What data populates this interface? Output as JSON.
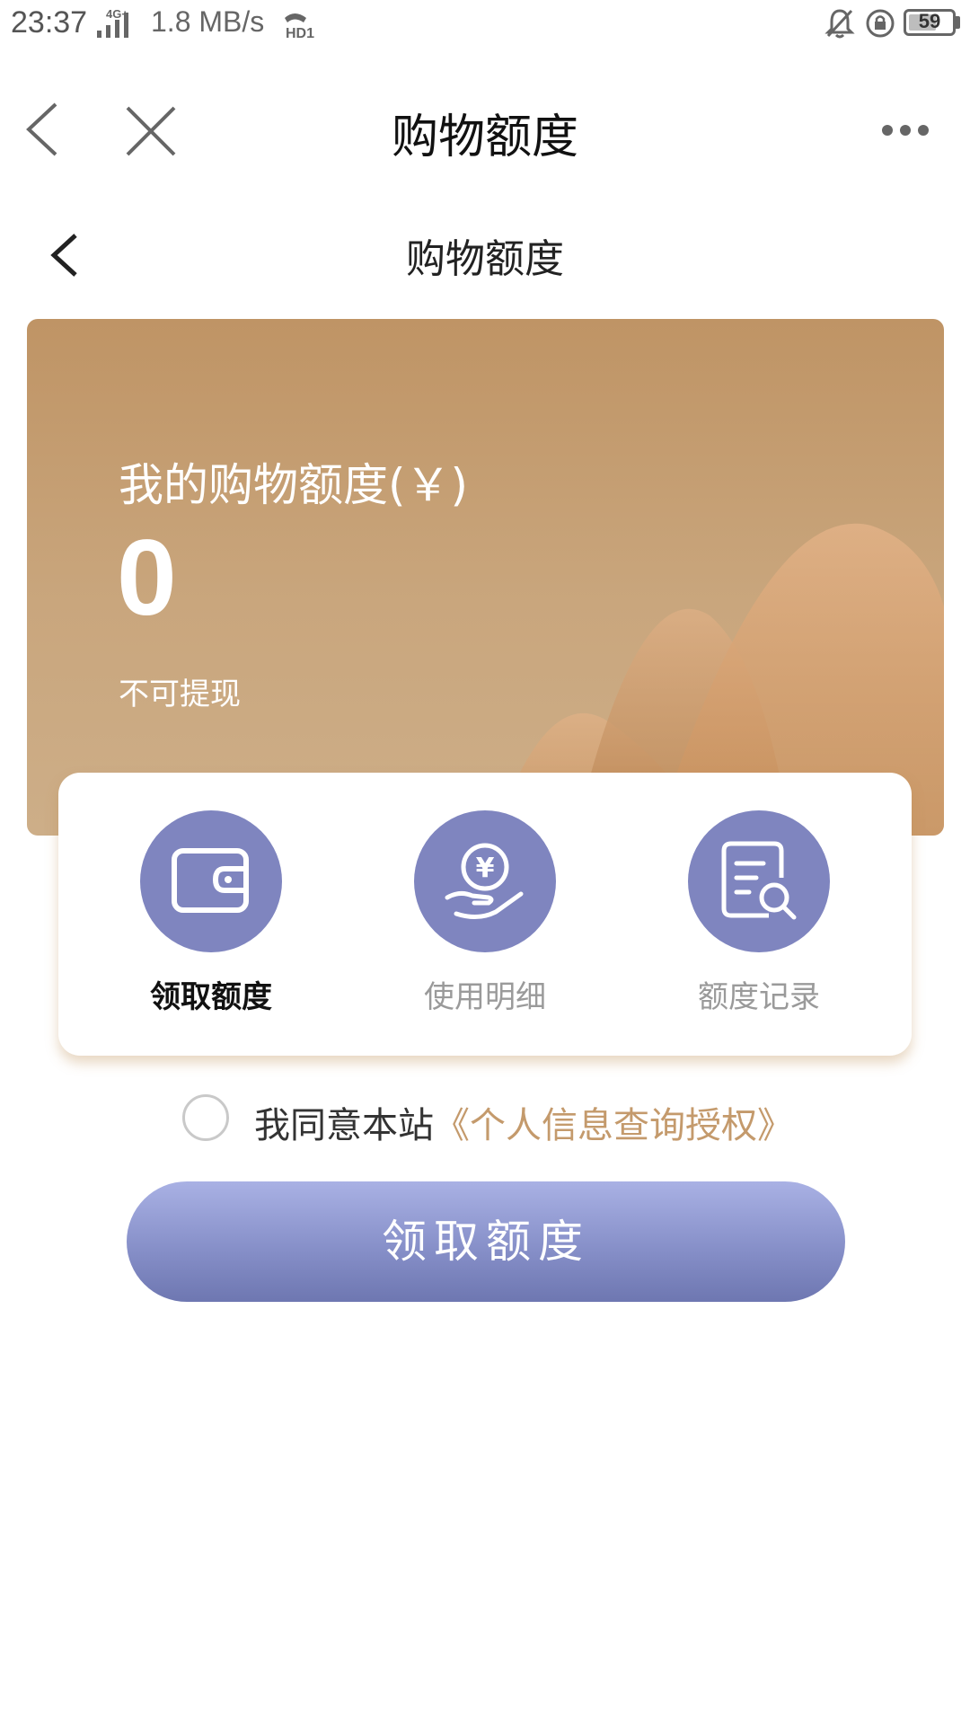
{
  "status_bar": {
    "time": "23:37",
    "network": "4G+",
    "speed": "1.8 MB/s",
    "hd": "HD1",
    "battery": "59"
  },
  "browser_nav": {
    "title": "购物额度"
  },
  "page_header": {
    "title": "购物额度"
  },
  "hero": {
    "label": "我的购物额度(￥)",
    "value": "0",
    "note": "不可提现",
    "colors": {
      "card_top": "#bf9465",
      "card_bottom": "#cdae88"
    }
  },
  "actions": [
    {
      "label": "领取额度",
      "icon": "wallet-icon",
      "active": true
    },
    {
      "label": "使用明细",
      "icon": "yuan-hand-icon",
      "active": false
    },
    {
      "label": "额度记录",
      "icon": "document-search-icon",
      "active": false
    }
  ],
  "agreement": {
    "prefix": "我同意本站",
    "link": "《个人信息查询授权》",
    "checked": false
  },
  "cta": {
    "label": "领取额度"
  },
  "theme": {
    "accent_purple": "#7f85bf",
    "link_gold": "#c49a6c"
  }
}
